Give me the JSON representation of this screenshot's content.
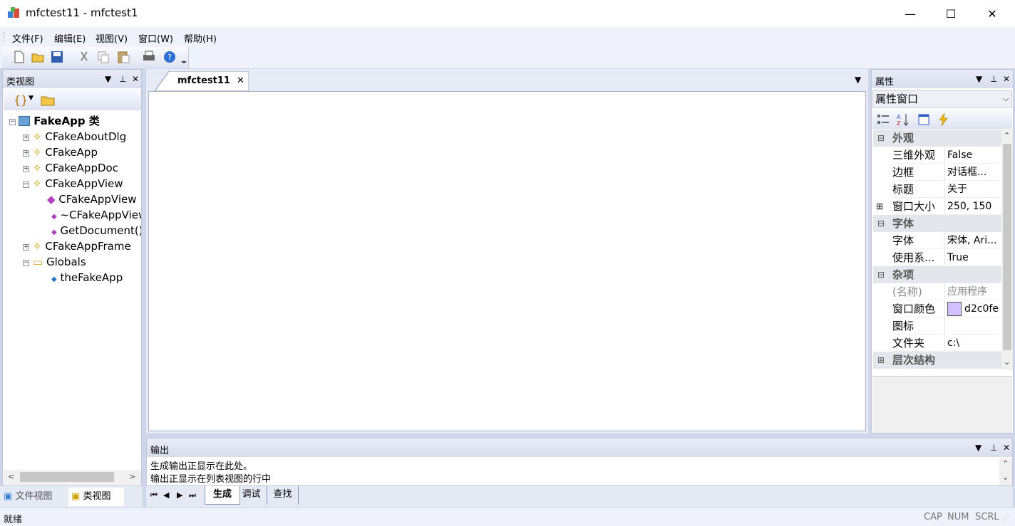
{
  "window": {
    "title": "mfctest11 - mfctest1",
    "min": "—",
    "max": "☐",
    "close": "✕"
  },
  "menu": [
    "文件(F)",
    "编辑(E)",
    "视图(V)",
    "窗口(W)",
    "帮助(H)"
  ],
  "classview": {
    "title": "类视图",
    "root": "FakeApp 类",
    "items": [
      "CFakeAboutDlg",
      "CFakeApp",
      "CFakeAppDoc",
      "CFakeAppView",
      "CFakeAppView",
      "~CFakeAppView",
      "GetDocument()",
      "CFakeAppFrame",
      "Globals",
      "theFakeApp"
    ],
    "tabs": [
      "文件视图",
      "类视图"
    ]
  },
  "document": {
    "tab": "mfctest11"
  },
  "properties": {
    "title": "属性",
    "combo": "属性窗口",
    "cat_appearance": "外观",
    "cat_font": "字体",
    "cat_misc": "杂项",
    "cat_hierarchy": "层次结构",
    "rows": [
      {
        "name": "三维外观",
        "value": "False"
      },
      {
        "name": "边框",
        "value": "对话框..."
      },
      {
        "name": "标题",
        "value": "关于"
      },
      {
        "name": "窗口大小",
        "value": "250, 150"
      },
      {
        "name": "字体",
        "value": "宋体, Ari..."
      },
      {
        "name": "使用系...",
        "value": "True"
      },
      {
        "name": "(名称)",
        "value": "应用程序"
      },
      {
        "name": "窗口颜色",
        "value": "d2c0fe"
      },
      {
        "name": "图标",
        "value": ""
      },
      {
        "name": "文件夹",
        "value": "c:\\"
      }
    ],
    "swatch_color": "#d2c0fe"
  },
  "output": {
    "title": "输出",
    "lines": [
      "生成输出正显示在此处。",
      "输出正显示在列表视图的行中"
    ],
    "tabs": [
      "生成",
      "调试",
      "查找"
    ]
  },
  "status": {
    "text": "就绪",
    "cap": "CAP",
    "num": "NUM",
    "scrl": "SCRL"
  },
  "icons": {
    "pin": "pin-icon",
    "close": "close-icon",
    "dropdown": "dropdown-icon"
  }
}
